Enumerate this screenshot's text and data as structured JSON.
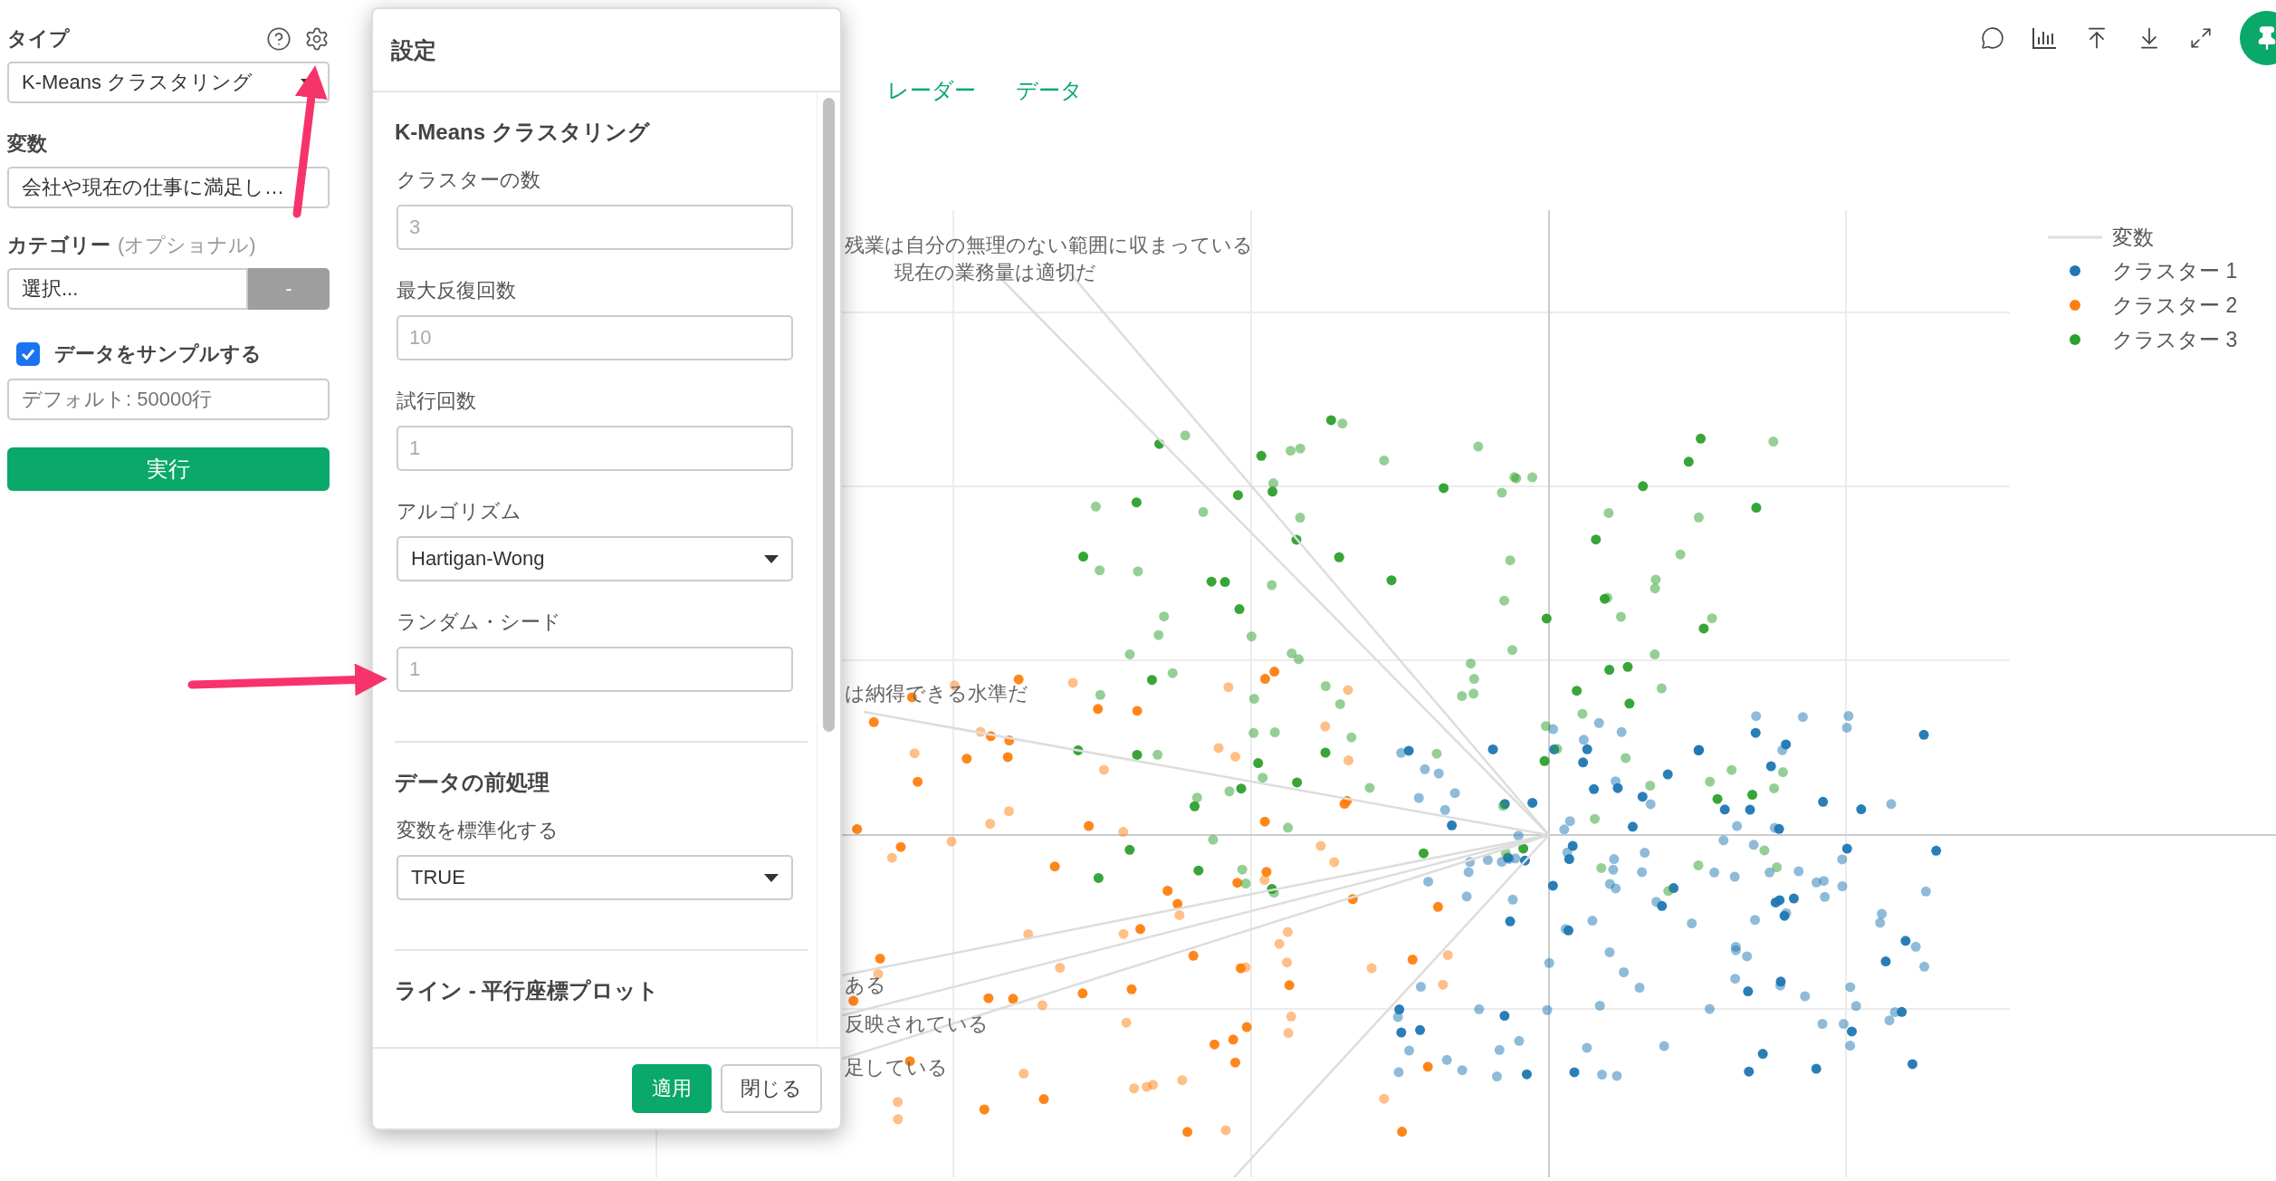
{
  "sidebar": {
    "type": {
      "label": "タイプ",
      "value": "K-Means クラスタリング"
    },
    "variables": {
      "label": "変数",
      "value": "会社や現在の仕事に満足し…"
    },
    "category": {
      "label": "カテゴリー",
      "hint": "(オプショナル)",
      "value": "選択...",
      "button": "-"
    },
    "sample": {
      "label": "データをサンプルする",
      "checked": true,
      "placeholder": "デフォルト: 50000行"
    },
    "run_button": "実行"
  },
  "tabs": [
    {
      "label": "レーダー"
    },
    {
      "label": "データ"
    }
  ],
  "chart": {
    "variable_labels": [
      {
        "text": "残業は自分の無理のない範囲に収まっている"
      },
      {
        "text": "現在の業務量は適切だ"
      },
      {
        "text": "は納得できる水準だ"
      },
      {
        "text": "ある"
      },
      {
        "text": "反映されている"
      },
      {
        "text": "足している"
      }
    ],
    "legend": {
      "title": "変数",
      "items": [
        {
          "label": "クラスター 1",
          "color": "#1f77b4"
        },
        {
          "label": "クラスター 2",
          "color": "#ff7f0e"
        },
        {
          "label": "クラスター 3",
          "color": "#2ca02c"
        }
      ]
    }
  },
  "dialog": {
    "title": "設定",
    "sections": [
      {
        "title": "K-Means クラスタリング",
        "fields": [
          {
            "kind": "input",
            "label": "クラスターの数",
            "placeholder": "3"
          },
          {
            "kind": "input",
            "label": "最大反復回数",
            "placeholder": "10"
          },
          {
            "kind": "input",
            "label": "試行回数",
            "placeholder": "1"
          },
          {
            "kind": "select",
            "label": "アルゴリズム",
            "value": "Hartigan-Wong"
          },
          {
            "kind": "input",
            "label": "ランダム・シード",
            "placeholder": "1"
          }
        ]
      },
      {
        "title": "データの前処理",
        "fields": [
          {
            "kind": "select",
            "label": "変数を標準化する",
            "value": "TRUE"
          }
        ]
      },
      {
        "title": "ライン - 平行座標プロット"
      }
    ],
    "buttons": [
      {
        "kind": "primary",
        "label": "適用"
      },
      {
        "kind": "secondary",
        "label": "閉じる"
      }
    ]
  }
}
